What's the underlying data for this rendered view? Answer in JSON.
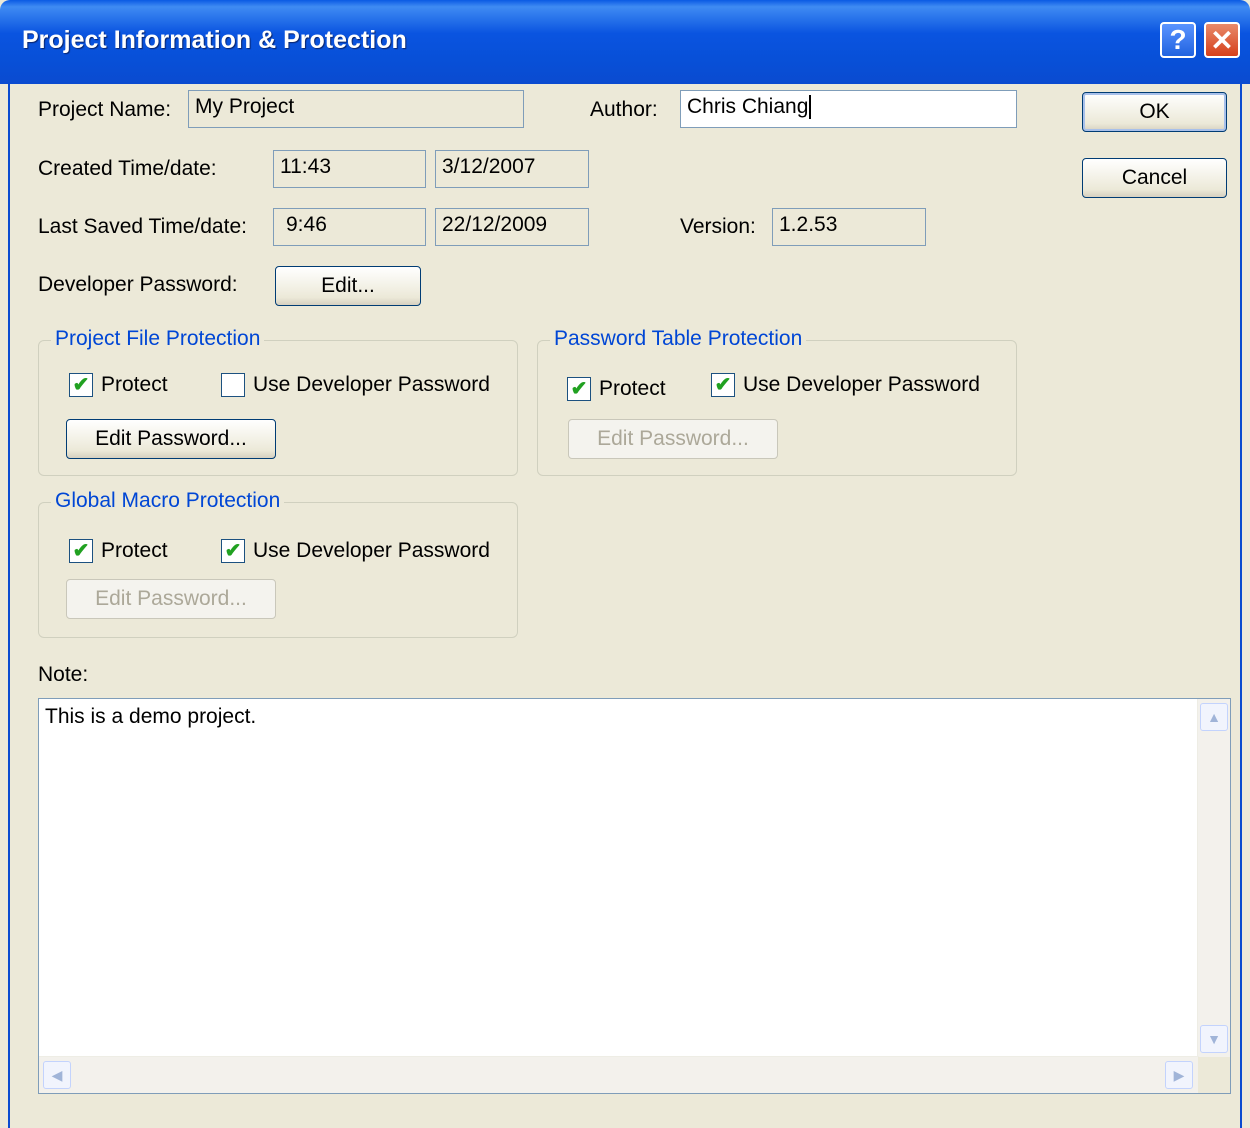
{
  "window": {
    "title": "Project Information & Protection",
    "help_glyph": "?",
    "close_glyph": "✕"
  },
  "project": {
    "name_label": "Project Name:",
    "name_value": "My Project",
    "author_label": "Author:",
    "author_value": "Chris Chiang",
    "created_label": "Created Time/date:",
    "created_time": "11:43",
    "created_date": "3/12/2007",
    "saved_label": "Last Saved Time/date:",
    "saved_time": "9:46",
    "saved_date": "22/12/2009",
    "version_label": "Version:",
    "version_value": "1.2.53",
    "dev_password_label": "Developer Password:",
    "dev_password_edit": "Edit..."
  },
  "buttons": {
    "ok": "OK",
    "cancel": "Cancel"
  },
  "groups": {
    "project_file": {
      "title": "Project File Protection",
      "protect_label": "Protect",
      "protect_checked": true,
      "use_dev_label": "Use Developer Password",
      "use_dev_checked": false,
      "edit_label": "Edit Password...",
      "edit_enabled": true
    },
    "password_table": {
      "title": "Password Table Protection",
      "protect_label": "Protect",
      "protect_checked": true,
      "use_dev_label": "Use Developer Password",
      "use_dev_checked": true,
      "edit_label": "Edit Password...",
      "edit_enabled": false
    },
    "global_macro": {
      "title": "Global Macro Protection",
      "protect_label": "Protect",
      "protect_checked": true,
      "use_dev_label": "Use Developer Password",
      "use_dev_checked": true,
      "edit_label": "Edit Password...",
      "edit_enabled": false
    }
  },
  "note": {
    "label": "Note:",
    "text": "This is a demo project."
  },
  "icons": {
    "check": "✔",
    "up": "▲",
    "down": "▼",
    "left": "◀",
    "right": "▶"
  },
  "colors": {
    "titlebar": "#0a54e0",
    "group_title": "#0046d5",
    "face": "#ece9d8",
    "check": "#21a121"
  }
}
